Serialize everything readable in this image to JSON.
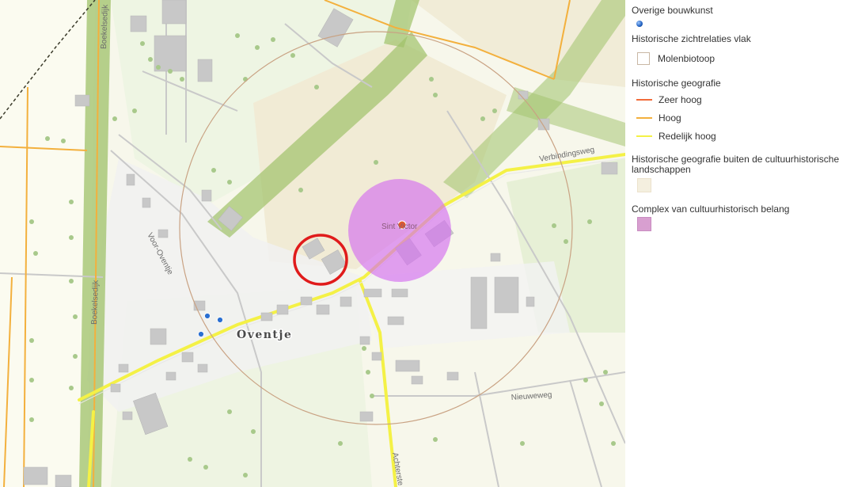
{
  "legend": {
    "overige_bouwkunst": {
      "title": "Overige bouwkunst"
    },
    "zichtrelaties": {
      "title": "Historische zichtrelaties vlak",
      "item": "Molenbiotoop"
    },
    "geografie": {
      "title": "Historische geografie",
      "items": [
        {
          "label": "Zeer hoog",
          "color": "#f26c3a"
        },
        {
          "label": "Hoog",
          "color": "#f3b03d"
        },
        {
          "label": "Redelijk hoog",
          "color": "#f4f146"
        }
      ]
    },
    "buiten": {
      "title": "Historische geografie buiten de cultuurhistorische landschappen"
    },
    "complex": {
      "title": "Complex van cultuurhistorisch belang",
      "color": "#d89fd0"
    }
  },
  "map": {
    "place": "Oventje",
    "windmill": "Sint Victor",
    "streets": {
      "boekelsedijk_north": "Boekelsedijk",
      "boekelsedijk_south": "Boekelsedijk",
      "voor_oventje": "Voor-Oventje",
      "verbindingsweg": "Verbindingsweg",
      "nieuweweg": "Nieuweweg",
      "achterste": "Achterste"
    },
    "colors": {
      "corridor": "#9fc26a",
      "historic_area": "#f1ebd5",
      "complex_circle": "#d46ef0",
      "molenbiotoop": "#c9a283",
      "highlight": "#e01b1b"
    }
  }
}
